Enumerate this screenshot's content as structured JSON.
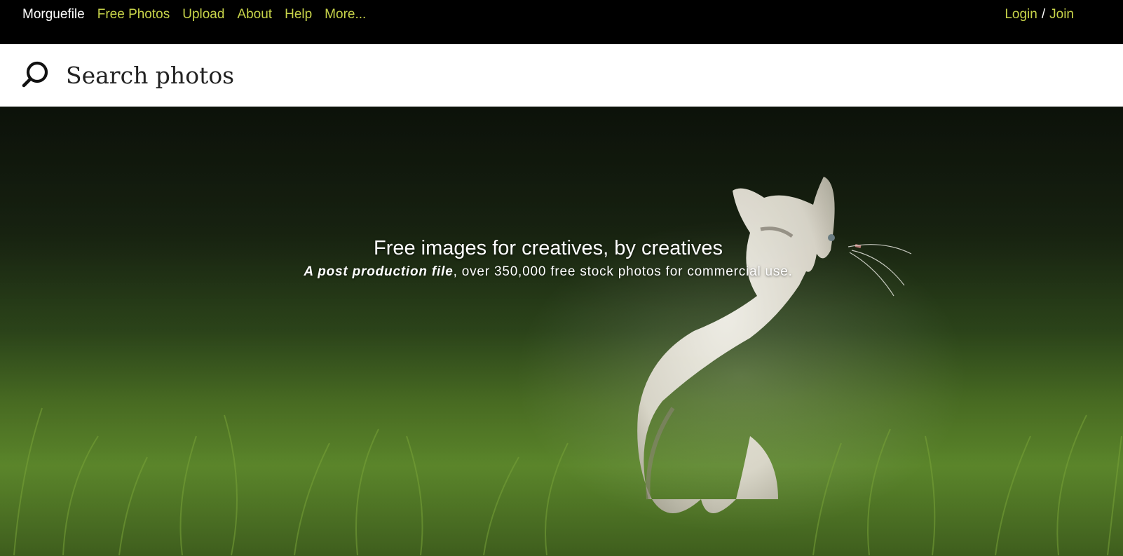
{
  "nav": {
    "brand": "Morguefile",
    "links": [
      "Free Photos",
      "Upload",
      "About",
      "Help",
      "More..."
    ],
    "link_color": "#c8d44a"
  },
  "auth": {
    "login": "Login",
    "separator": "/",
    "join": "Join"
  },
  "search": {
    "icon": "search-icon",
    "placeholder": "Search photos"
  },
  "hero": {
    "headline": "Free images for creatives, by creatives",
    "sub_emphasis": "A post production file",
    "sub_rest": ", over 350,000 free stock photos for commercial use."
  }
}
